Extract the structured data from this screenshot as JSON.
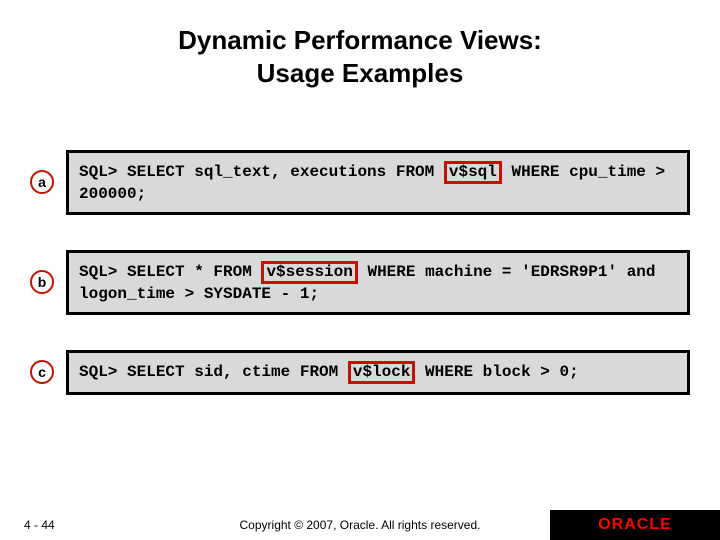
{
  "title_line1": "Dynamic Performance Views:",
  "title_line2": "Usage Examples",
  "examples": {
    "a": {
      "marker": "a",
      "pre": "SQL> SELECT sql_text, executions FROM ",
      "hl": "v$sql",
      "post1": " WHERE cpu_time > 200000;"
    },
    "b": {
      "marker": "b",
      "pre": "SQL> SELECT * FROM ",
      "hl": "v$session",
      "post1": " WHERE machine = 'EDRSR9P1' and logon_time > SYSDATE - 1;"
    },
    "c": {
      "marker": "c",
      "pre": "SQL> SELECT sid, ctime FROM ",
      "hl": "v$lock",
      "post1": " WHERE block > 0;"
    }
  },
  "footer": {
    "page": "4 - 44",
    "copyright": "Copyright © 2007, Oracle. All rights reserved.",
    "brand": "ORACLE"
  }
}
